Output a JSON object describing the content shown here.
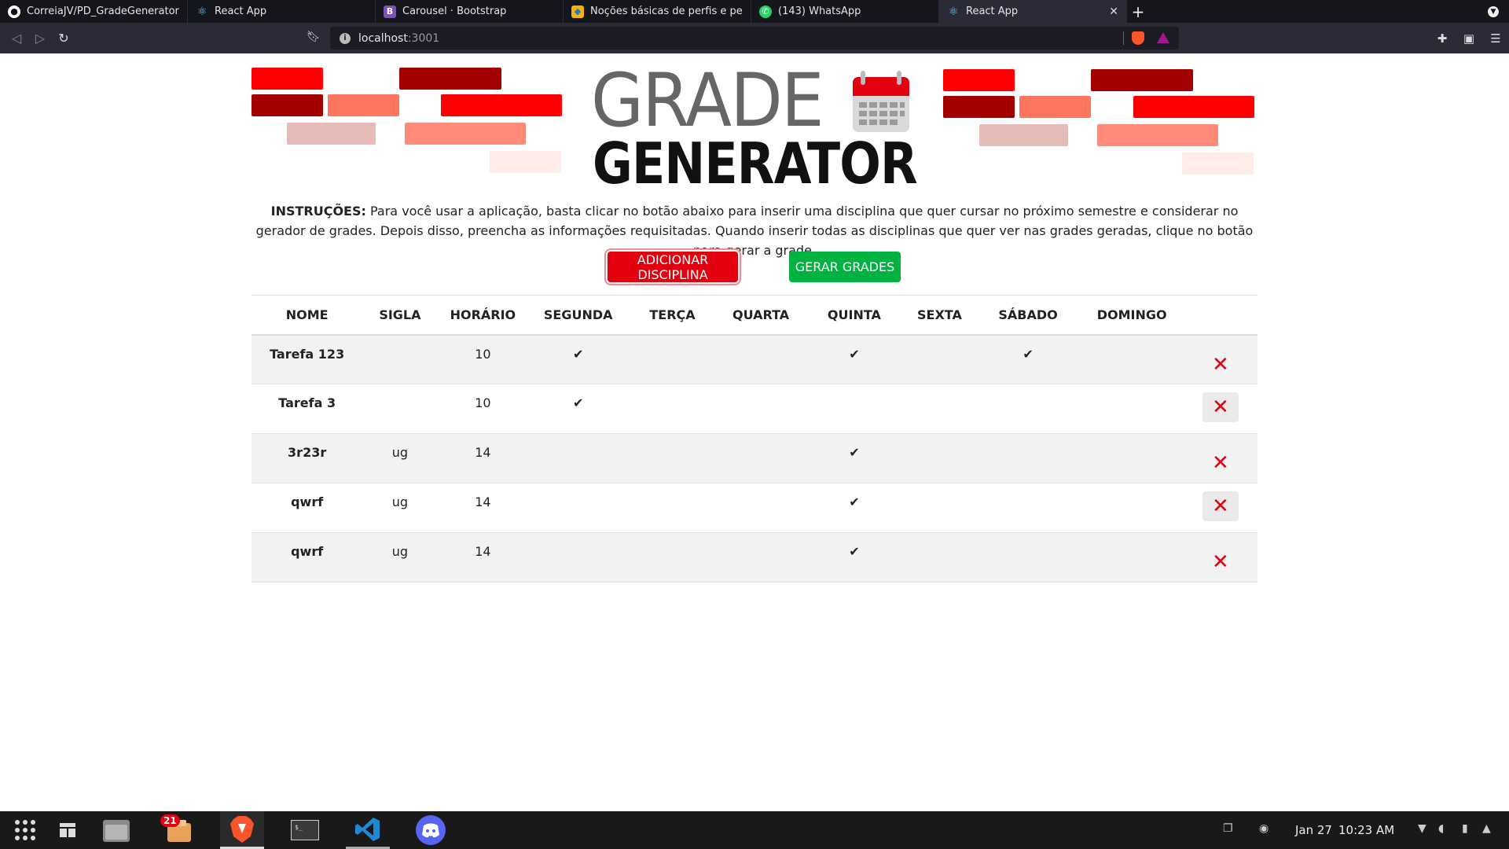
{
  "browser": {
    "tabs": [
      {
        "title": "CorreiaJV/PD_GradeGenerator: Pro",
        "icon": "github-icon",
        "active": false
      },
      {
        "title": "React App",
        "icon": "react-icon",
        "active": false
      },
      {
        "title": "Carousel · Bootstrap",
        "icon": "bootstrap-icon",
        "active": false
      },
      {
        "title": "Noções básicas de perfis e permis",
        "icon": "google-cloud-icon",
        "active": false
      },
      {
        "title": "(143) WhatsApp",
        "icon": "whatsapp-icon",
        "active": false
      },
      {
        "title": "React App",
        "icon": "react-icon",
        "active": true
      }
    ],
    "new_tab_symbol": "+",
    "url_host": "localhost",
    "url_port": ":3001"
  },
  "app": {
    "logo_line1": "GRADE",
    "logo_line2": "GENERATOR",
    "instructions_label": "INSTRUÇÕES:",
    "instructions_text": " Para você usar a aplicação, basta clicar no botão abaixo para inserir uma disciplina que quer cursar no próximo semestre e considerar no gerador de grades. Depois disso, preencha as informações requisitadas. Quando inserir todas as disciplinas que quer ver nas grades geradas, clique no botão para gerar a grade.",
    "add_button": "ADICIONAR DISCIPLINA",
    "generate_button": "GERAR GRADES",
    "colors": {
      "accent_red": "#e3000f",
      "accent_green": "#00b341"
    }
  },
  "table": {
    "headers": [
      "NOME",
      "SIGLA",
      "HORÁRIO",
      "SEGUNDA",
      "TERÇA",
      "QUARTA",
      "QUINTA",
      "SEXTA",
      "SÁBADO",
      "DOMINGO"
    ],
    "check_symbol": "✔",
    "delete_symbol": "✕",
    "rows": [
      {
        "nome": "Tarefa 123",
        "sigla": "",
        "horario": "10",
        "seg": "✔",
        "ter": "",
        "qua": "",
        "qui": "✔",
        "sex": "",
        "sab": "✔",
        "dom": ""
      },
      {
        "nome": "Tarefa 3",
        "sigla": "",
        "horario": "10",
        "seg": "✔",
        "ter": "",
        "qua": "",
        "qui": "",
        "sex": "",
        "sab": "",
        "dom": ""
      },
      {
        "nome": "3r23r",
        "sigla": "ug",
        "horario": "14",
        "seg": "",
        "ter": "",
        "qua": "",
        "qui": "✔",
        "sex": "",
        "sab": "",
        "dom": ""
      },
      {
        "nome": "qwrf",
        "sigla": "ug",
        "horario": "14",
        "seg": "",
        "ter": "",
        "qua": "",
        "qui": "✔",
        "sex": "",
        "sab": "",
        "dom": ""
      },
      {
        "nome": "qwrf",
        "sigla": "ug",
        "horario": "14",
        "seg": "",
        "ter": "",
        "qua": "",
        "qui": "✔",
        "sex": "",
        "sab": "",
        "dom": ""
      }
    ]
  },
  "taskbar": {
    "notification_badge": "21",
    "date": "Jan 27",
    "time": "10:23 AM"
  }
}
